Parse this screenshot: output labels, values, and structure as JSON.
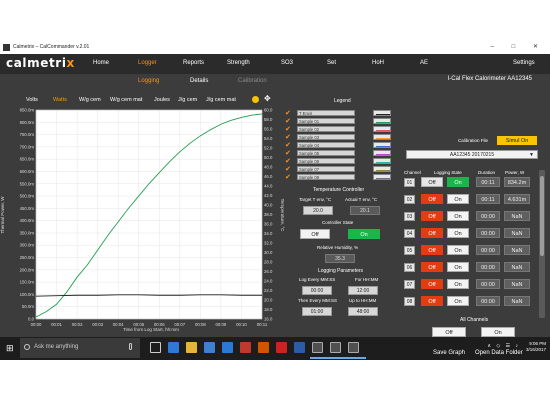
{
  "window": {
    "title": "Calmetrix – CalCommander v.2.01"
  },
  "logo": {
    "part1": "calmetri",
    "part2": "x"
  },
  "menu": [
    "Home",
    "Logger",
    "Reports",
    "Strength",
    "SO3",
    "Set",
    "HoH",
    "AE",
    "Settings"
  ],
  "menu_active": "Logger",
  "submenu": [
    "Logging",
    "Details",
    "Calibration"
  ],
  "device": "I-Cal Flex Calorimeter AA12345",
  "units": [
    "Volts",
    "Watts",
    "W/g cem",
    "W/g cem mat",
    "Joules",
    "J/g cem",
    "J/g cem mat"
  ],
  "units_active": "Watts",
  "legend": {
    "title": "Legend",
    "items": [
      {
        "name": "T Envir",
        "color": "#222222"
      },
      {
        "name": "Sample 01",
        "color": "#1f9e4f"
      },
      {
        "name": "Sample 02",
        "color": "#e05555"
      },
      {
        "name": "Sample 03",
        "color": "#f0a030"
      },
      {
        "name": "Sample 04",
        "color": "#3a6fd0"
      },
      {
        "name": "Sample 05",
        "color": "#b050c0"
      },
      {
        "name": "Sample 06",
        "color": "#30b0b0"
      },
      {
        "name": "Sample 07",
        "color": "#a08040"
      },
      {
        "name": "Sample 08",
        "color": "#7070a0"
      }
    ]
  },
  "temp": {
    "title": "Temperature Controller",
    "target_label": "Target T env, °C",
    "target_value": "20.0",
    "actual_label": "Actual T env, °C",
    "actual_value": "20.1",
    "state_label": "Controller State",
    "off": "Off",
    "on": "On",
    "rh_label": "Relative Humidity, %",
    "rh_value": "35.3"
  },
  "logging": {
    "title": "Logging Parameters",
    "log_every_label": "Log Every MM:SS",
    "log_every_value": "00:00",
    "for_label": "For HH:MM",
    "for_value": "12:00",
    "then_label": "Then Every MM:SS",
    "then_value": "01:00",
    "upto_label": "Up to HH:MM",
    "upto_value": "48:00"
  },
  "calibration": {
    "label": "Calibration File",
    "button": "Simul On",
    "file": "AA12345 20170215"
  },
  "channel_headers": {
    "channel": "Channel",
    "state": "Logging State",
    "duration": "Duration",
    "power": "Power, W"
  },
  "channels": [
    {
      "num": "01",
      "off": "Off",
      "on": "On",
      "state": "on",
      "duration": "00:11",
      "power": "834.2m"
    },
    {
      "num": "02",
      "off": "Off",
      "on": "On",
      "state": "off",
      "duration": "00:11",
      "power": "4.631m"
    },
    {
      "num": "03",
      "off": "Off",
      "on": "On",
      "state": "off",
      "duration": "00:00",
      "power": "NaN"
    },
    {
      "num": "04",
      "off": "Off",
      "on": "On",
      "state": "off",
      "duration": "00:00",
      "power": "NaN"
    },
    {
      "num": "05",
      "off": "Off",
      "on": "On",
      "state": "off",
      "duration": "00:00",
      "power": "NaN"
    },
    {
      "num": "06",
      "off": "Off",
      "on": "On",
      "state": "off",
      "duration": "00:00",
      "power": "NaN"
    },
    {
      "num": "07",
      "off": "Off",
      "on": "On",
      "state": "off",
      "duration": "00:00",
      "power": "NaN"
    },
    {
      "num": "08",
      "off": "Off",
      "on": "On",
      "state": "off",
      "duration": "00:00",
      "power": "NaN"
    }
  ],
  "all_channels": {
    "label": "All Channels",
    "off": "Off",
    "on": "On"
  },
  "actions": {
    "save_graph": "Save Graph",
    "open_folder": "Open Data Folder"
  },
  "taskbar": {
    "search_placeholder": "Ask me anything",
    "time": "9:06 PM",
    "date": "3/16/2017"
  },
  "chart_data": {
    "type": "line",
    "xlabel": "Time from Log Start, hh:mm",
    "ylabel": "Thermal Power, W",
    "ylabel_right": "Temperature, °C",
    "x_ticks": [
      "00:00",
      "00:01",
      "00:02",
      "00:03",
      "00:04",
      "00:05",
      "00:06",
      "00:07",
      "00:08",
      "00:09",
      "00:10",
      "00:11"
    ],
    "y_ticks": [
      "0.0",
      "50.0m",
      "100.0m",
      "150.0m",
      "200.0m",
      "250.0m",
      "300.0m",
      "350.0m",
      "400.0m",
      "450.0m",
      "500.0m",
      "550.0m",
      "600.0m",
      "650.0m",
      "700.0m",
      "750.0m",
      "800.0m",
      "850.0m"
    ],
    "y_ticks_right": [
      "16.0",
      "18.0",
      "20.0",
      "22.0",
      "24.0",
      "26.0",
      "28.0",
      "30.0",
      "32.0",
      "34.0",
      "36.0",
      "38.0",
      "40.0",
      "42.0",
      "44.0",
      "46.0",
      "48.0",
      "50.0",
      "52.0",
      "54.0",
      "56.0",
      "58.0",
      "60.0"
    ],
    "xlim": [
      0,
      11
    ],
    "ylim": [
      0,
      850
    ],
    "ylim_right": [
      16,
      60
    ],
    "grid": true,
    "series": [
      {
        "name": "Sample 01",
        "color": "#1f9e4f",
        "axis": "left",
        "x": [
          0,
          0.5,
          1,
          1.5,
          2,
          2.5,
          3,
          3.5,
          4,
          4.5,
          5,
          5.5,
          6,
          6.5,
          7,
          7.5,
          8,
          8.5,
          9,
          9.5,
          10,
          10.5,
          11
        ],
        "y": [
          8,
          30,
          60,
          110,
          170,
          220,
          280,
          340,
          395,
          450,
          500,
          550,
          595,
          640,
          680,
          715,
          745,
          770,
          792,
          808,
          820,
          829,
          834
        ]
      },
      {
        "name": "T Envir",
        "color": "#222222",
        "axis": "right",
        "x": [
          0,
          1,
          2,
          3,
          4,
          5,
          6,
          7,
          8,
          9,
          10,
          11
        ],
        "y": [
          20.8,
          20.9,
          21.0,
          21.0,
          21.1,
          21.1,
          21.0,
          21.0,
          21.1,
          21.1,
          21.0,
          21.0
        ]
      }
    ]
  }
}
